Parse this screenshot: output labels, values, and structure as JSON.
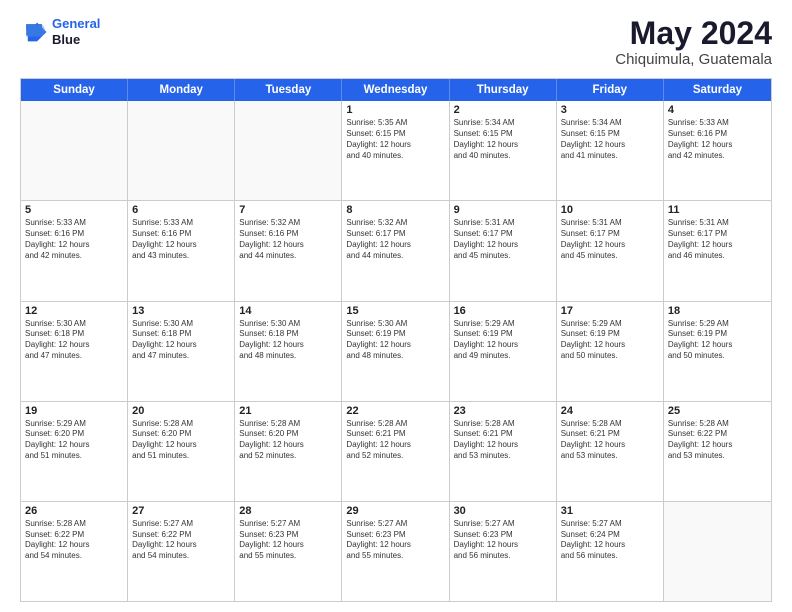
{
  "header": {
    "logo_line1": "General",
    "logo_line2": "Blue",
    "month_title": "May 2024",
    "location": "Chiquimula, Guatemala"
  },
  "weekdays": [
    "Sunday",
    "Monday",
    "Tuesday",
    "Wednesday",
    "Thursday",
    "Friday",
    "Saturday"
  ],
  "rows": [
    [
      {
        "day": "",
        "info": ""
      },
      {
        "day": "",
        "info": ""
      },
      {
        "day": "",
        "info": ""
      },
      {
        "day": "1",
        "info": "Sunrise: 5:35 AM\nSunset: 6:15 PM\nDaylight: 12 hours\nand 40 minutes."
      },
      {
        "day": "2",
        "info": "Sunrise: 5:34 AM\nSunset: 6:15 PM\nDaylight: 12 hours\nand 40 minutes."
      },
      {
        "day": "3",
        "info": "Sunrise: 5:34 AM\nSunset: 6:15 PM\nDaylight: 12 hours\nand 41 minutes."
      },
      {
        "day": "4",
        "info": "Sunrise: 5:33 AM\nSunset: 6:16 PM\nDaylight: 12 hours\nand 42 minutes."
      }
    ],
    [
      {
        "day": "5",
        "info": "Sunrise: 5:33 AM\nSunset: 6:16 PM\nDaylight: 12 hours\nand 42 minutes."
      },
      {
        "day": "6",
        "info": "Sunrise: 5:33 AM\nSunset: 6:16 PM\nDaylight: 12 hours\nand 43 minutes."
      },
      {
        "day": "7",
        "info": "Sunrise: 5:32 AM\nSunset: 6:16 PM\nDaylight: 12 hours\nand 44 minutes."
      },
      {
        "day": "8",
        "info": "Sunrise: 5:32 AM\nSunset: 6:17 PM\nDaylight: 12 hours\nand 44 minutes."
      },
      {
        "day": "9",
        "info": "Sunrise: 5:31 AM\nSunset: 6:17 PM\nDaylight: 12 hours\nand 45 minutes."
      },
      {
        "day": "10",
        "info": "Sunrise: 5:31 AM\nSunset: 6:17 PM\nDaylight: 12 hours\nand 45 minutes."
      },
      {
        "day": "11",
        "info": "Sunrise: 5:31 AM\nSunset: 6:17 PM\nDaylight: 12 hours\nand 46 minutes."
      }
    ],
    [
      {
        "day": "12",
        "info": "Sunrise: 5:30 AM\nSunset: 6:18 PM\nDaylight: 12 hours\nand 47 minutes."
      },
      {
        "day": "13",
        "info": "Sunrise: 5:30 AM\nSunset: 6:18 PM\nDaylight: 12 hours\nand 47 minutes."
      },
      {
        "day": "14",
        "info": "Sunrise: 5:30 AM\nSunset: 6:18 PM\nDaylight: 12 hours\nand 48 minutes."
      },
      {
        "day": "15",
        "info": "Sunrise: 5:30 AM\nSunset: 6:19 PM\nDaylight: 12 hours\nand 48 minutes."
      },
      {
        "day": "16",
        "info": "Sunrise: 5:29 AM\nSunset: 6:19 PM\nDaylight: 12 hours\nand 49 minutes."
      },
      {
        "day": "17",
        "info": "Sunrise: 5:29 AM\nSunset: 6:19 PM\nDaylight: 12 hours\nand 50 minutes."
      },
      {
        "day": "18",
        "info": "Sunrise: 5:29 AM\nSunset: 6:19 PM\nDaylight: 12 hours\nand 50 minutes."
      }
    ],
    [
      {
        "day": "19",
        "info": "Sunrise: 5:29 AM\nSunset: 6:20 PM\nDaylight: 12 hours\nand 51 minutes."
      },
      {
        "day": "20",
        "info": "Sunrise: 5:28 AM\nSunset: 6:20 PM\nDaylight: 12 hours\nand 51 minutes."
      },
      {
        "day": "21",
        "info": "Sunrise: 5:28 AM\nSunset: 6:20 PM\nDaylight: 12 hours\nand 52 minutes."
      },
      {
        "day": "22",
        "info": "Sunrise: 5:28 AM\nSunset: 6:21 PM\nDaylight: 12 hours\nand 52 minutes."
      },
      {
        "day": "23",
        "info": "Sunrise: 5:28 AM\nSunset: 6:21 PM\nDaylight: 12 hours\nand 53 minutes."
      },
      {
        "day": "24",
        "info": "Sunrise: 5:28 AM\nSunset: 6:21 PM\nDaylight: 12 hours\nand 53 minutes."
      },
      {
        "day": "25",
        "info": "Sunrise: 5:28 AM\nSunset: 6:22 PM\nDaylight: 12 hours\nand 53 minutes."
      }
    ],
    [
      {
        "day": "26",
        "info": "Sunrise: 5:28 AM\nSunset: 6:22 PM\nDaylight: 12 hours\nand 54 minutes."
      },
      {
        "day": "27",
        "info": "Sunrise: 5:27 AM\nSunset: 6:22 PM\nDaylight: 12 hours\nand 54 minutes."
      },
      {
        "day": "28",
        "info": "Sunrise: 5:27 AM\nSunset: 6:23 PM\nDaylight: 12 hours\nand 55 minutes."
      },
      {
        "day": "29",
        "info": "Sunrise: 5:27 AM\nSunset: 6:23 PM\nDaylight: 12 hours\nand 55 minutes."
      },
      {
        "day": "30",
        "info": "Sunrise: 5:27 AM\nSunset: 6:23 PM\nDaylight: 12 hours\nand 56 minutes."
      },
      {
        "day": "31",
        "info": "Sunrise: 5:27 AM\nSunset: 6:24 PM\nDaylight: 12 hours\nand 56 minutes."
      },
      {
        "day": "",
        "info": ""
      }
    ]
  ]
}
